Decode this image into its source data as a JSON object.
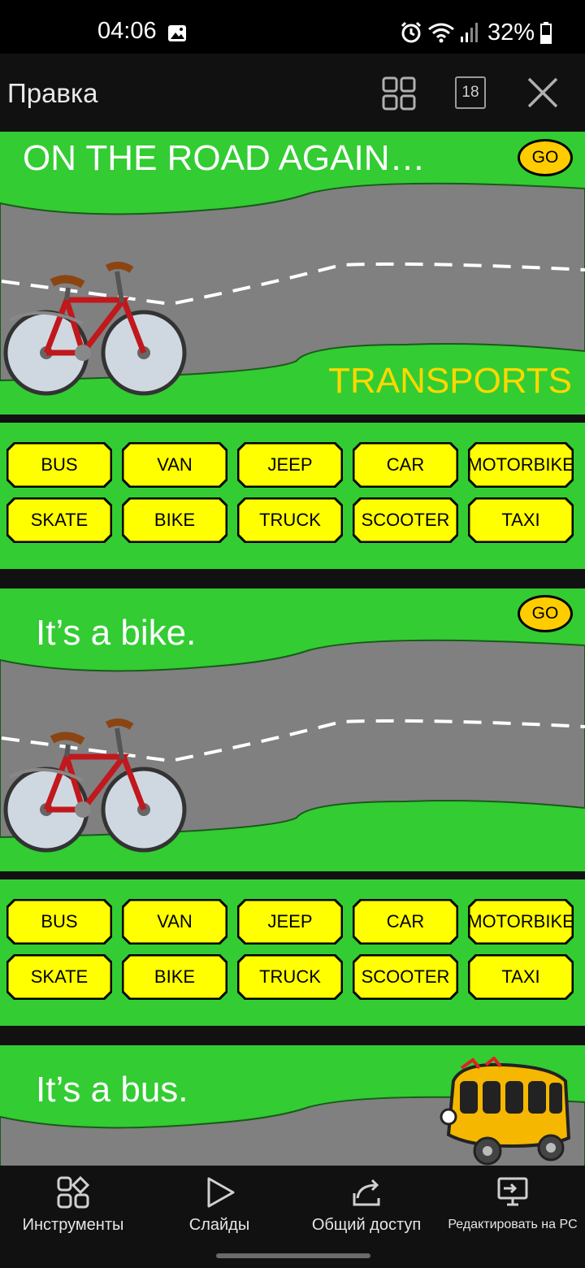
{
  "status": {
    "time": "04:06",
    "battery": "32%"
  },
  "appbar": {
    "title": "Правка",
    "slide_count": "18"
  },
  "slides": [
    {
      "title": "ON THE ROAD AGAIN…",
      "subtitle": "TRANSPORTS",
      "go": "GO",
      "vehicle_icon": "bicycle-icon"
    },
    {
      "title": "It’s a bike.",
      "go": "GO",
      "vehicle_icon": "bicycle-icon"
    },
    {
      "title": "It’s a bus.",
      "vehicle_icon": "bus-icon"
    }
  ],
  "transport_buttons": {
    "row1": [
      "BUS",
      "VAN",
      "JEEP",
      "CAR",
      "MOTORBIKE"
    ],
    "row2": [
      "SKATE",
      "BIKE",
      "TRUCK",
      "SCOOTER",
      "TAXI"
    ]
  },
  "bottom_nav": [
    {
      "label": "Инструменты",
      "icon": "tools-icon"
    },
    {
      "label": "Слайды",
      "icon": "play-icon"
    },
    {
      "label": "Общий доступ",
      "icon": "share-icon"
    },
    {
      "label": "Редактировать на PC",
      "icon": "pc-icon"
    }
  ],
  "colors": {
    "slide_green": "#33cc33",
    "button_yellow": "#ffff00",
    "go_yellow": "#ffcc00",
    "subtitle_yellow": "#ffd800",
    "road_gray": "#808080"
  }
}
